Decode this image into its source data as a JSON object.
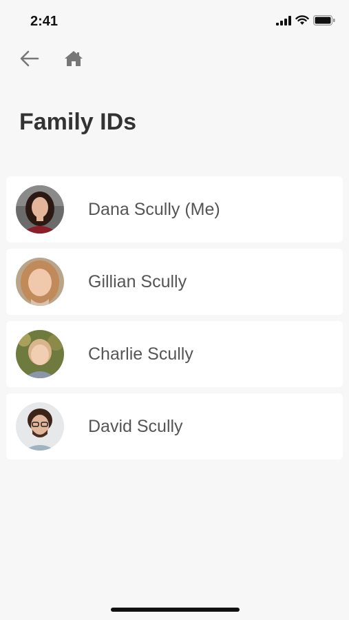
{
  "status_bar": {
    "time": "2:41"
  },
  "nav": {
    "back_icon": "arrow-left-icon",
    "home_icon": "home-icon"
  },
  "page": {
    "title": "Family IDs"
  },
  "members": [
    {
      "name": "Dana Scully (Me)",
      "avatar": "avatar-photo"
    },
    {
      "name": "Gillian Scully",
      "avatar": "avatar-photo"
    },
    {
      "name": "Charlie Scully",
      "avatar": "avatar-photo"
    },
    {
      "name": "David Scully",
      "avatar": "avatar-photo"
    }
  ],
  "colors": {
    "background": "#f7f7f7",
    "card": "#ffffff",
    "text": "#333333",
    "icon": "#777777"
  }
}
